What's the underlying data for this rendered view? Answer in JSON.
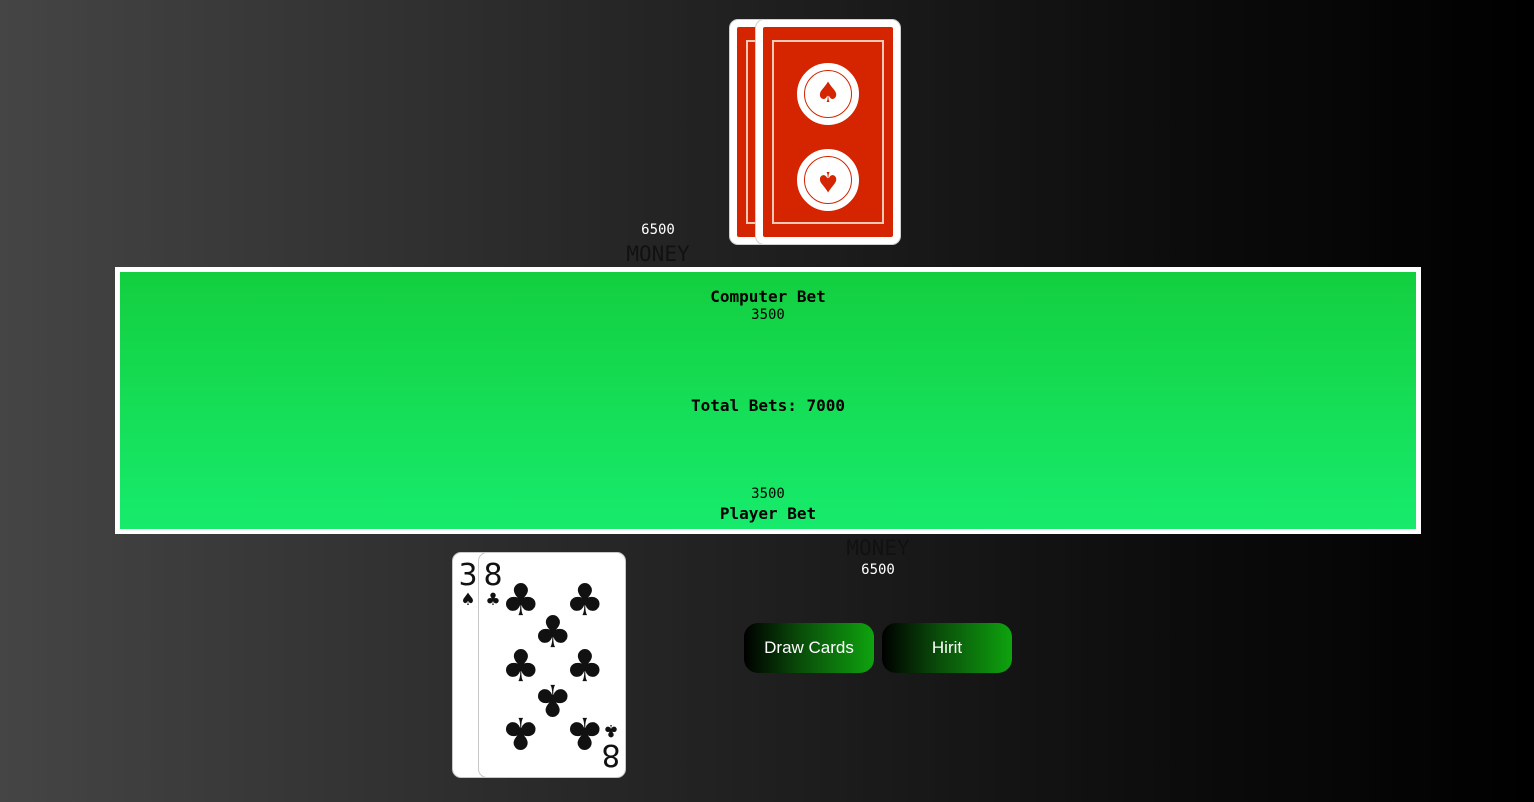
{
  "computer": {
    "money_label": "MONEY",
    "money_value": "6500",
    "cards": [
      {
        "state": "face-down",
        "back_design": "American Contract Bridge League"
      },
      {
        "state": "face-down",
        "back_design": "American Contract Bridge League"
      }
    ]
  },
  "table": {
    "computer_bet_label": "Computer Bet",
    "computer_bet_value": "3500",
    "total_bets": "Total Bets: 7000",
    "player_bet_value": "3500",
    "player_bet_label": "Player Bet"
  },
  "player": {
    "money_label": "MONEY",
    "money_value": "6500",
    "cards": [
      {
        "rank": "3",
        "suit": "♠"
      },
      {
        "rank": "8",
        "suit": "♣"
      }
    ]
  },
  "buttons": {
    "draw": "Draw Cards",
    "hirit": "Hirit"
  },
  "colors": {
    "table_green": "#13cf3f",
    "card_back_red": "#d42400",
    "button_green": "#0ea30e"
  }
}
